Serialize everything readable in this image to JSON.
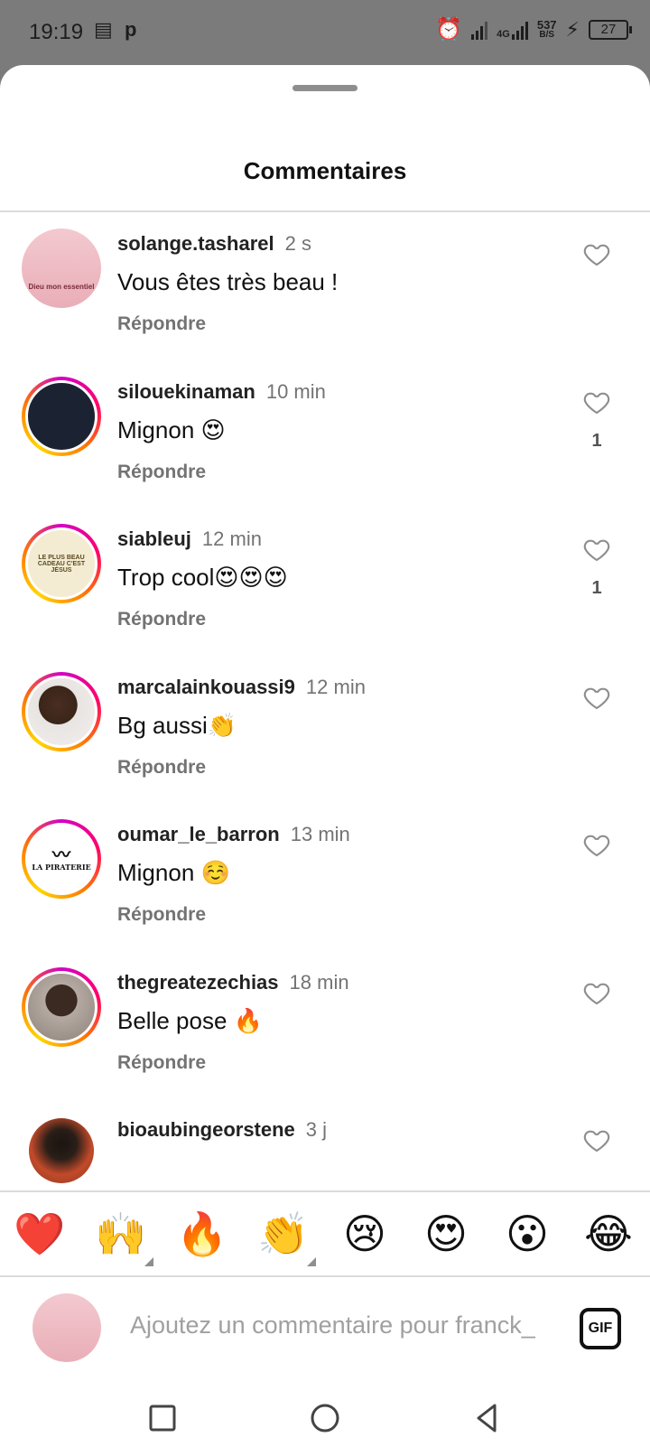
{
  "status_bar": {
    "time": "19:19",
    "network": "4G",
    "speed_value": "537",
    "speed_unit": "B/S",
    "battery": "27"
  },
  "sheet": {
    "title": "Commentaires"
  },
  "comments": [
    {
      "username": "solange.tasharel",
      "time": "2 s",
      "text": "Vous êtes très beau !",
      "reply": "Répondre",
      "likes": "",
      "avatar_text": "Dieu mon essentiel",
      "ring": false
    },
    {
      "username": "silouekinaman",
      "time": "10 min",
      "text": "Mignon 😍",
      "reply": "Répondre",
      "likes": "1",
      "avatar_text": "",
      "ring": true
    },
    {
      "username": "siableuj",
      "time": "12 min",
      "text": "Trop cool😍😍😍",
      "reply": "Répondre",
      "likes": "1",
      "avatar_text": "LE PLUS BEAU CADEAU C'EST JÉSUS",
      "ring": true
    },
    {
      "username": "marcalainkouassi9",
      "time": "12 min",
      "text": "Bg aussi👏",
      "reply": "Répondre",
      "likes": "",
      "avatar_text": "",
      "ring": true
    },
    {
      "username": "oumar_le_barron",
      "time": "13 min",
      "text": "Mignon ☺️",
      "reply": "Répondre",
      "likes": "",
      "avatar_text": "LA PIRATERIE",
      "ring": true
    },
    {
      "username": "thegreatezechias",
      "time": "18 min",
      "text": "Belle pose 🔥",
      "reply": "Répondre",
      "likes": "",
      "avatar_text": "",
      "ring": true
    },
    {
      "username": "bioaubingeorstene",
      "time": "3 j",
      "text": "",
      "reply": "",
      "likes": "",
      "avatar_text": "",
      "ring": false
    }
  ],
  "emoji_bar": [
    "❤️",
    "🙌",
    "🔥",
    "👏",
    "😢",
    "😍",
    "😮",
    "😂"
  ],
  "input": {
    "placeholder": "Ajoutez un commentaire pour franck_",
    "gif_label": "GIF"
  },
  "colors": {
    "ring_start": "#d300c5",
    "ring_end": "#ffd600",
    "secondary_text": "#737373"
  },
  "icons": {
    "like": "heart-outline-icon",
    "nav": [
      "square-recents-icon",
      "circle-home-icon",
      "triangle-back-icon"
    ]
  }
}
